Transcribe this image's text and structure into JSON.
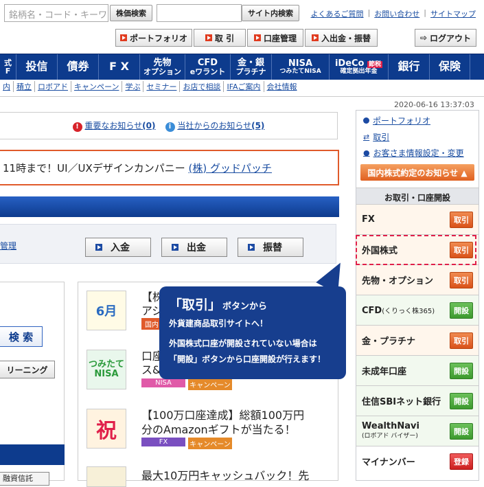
{
  "header": {
    "search_placeholder": "銘柄名・コード・キーワ",
    "stock_search": "株価検索",
    "site_search": "サイト内検索",
    "links": [
      "よくあるご質問",
      "お問い合わせ",
      "サイトマップ"
    ],
    "buttons": [
      "ポートフォリオ",
      "取 引",
      "口座管理",
      "入出金・振替"
    ],
    "logout": "ログアウト"
  },
  "nav": {
    "items": [
      {
        "l1": "式",
        "l2": "F"
      },
      {
        "l1": "投信",
        "l2": ""
      },
      {
        "l1": "債券",
        "l2": ""
      },
      {
        "l1": "F X",
        "l2": ""
      },
      {
        "l1": "先物",
        "l2": "オプション"
      },
      {
        "l1": "CFD",
        "l2": "eワラント"
      },
      {
        "l1": "金・銀",
        "l2": "プラチナ"
      },
      {
        "l1": "NISA",
        "l2": "つみたてNISA"
      },
      {
        "l1": "iDeCo",
        "l2": "確定拠出年金"
      },
      {
        "l1": "銀行",
        "l2": ""
      },
      {
        "l1": "保険",
        "l2": ""
      }
    ],
    "ideco_badge": "節税",
    "sub": [
      "内",
      "積立",
      "ロボアド",
      "キャンペーン",
      "学ぶ",
      "セミナー",
      "お店で相談",
      "IFAご案内",
      "会社情報"
    ]
  },
  "notices": {
    "important": "重要なお知らせ",
    "important_count": "(0)",
    "company": "当社からのお知らせ",
    "company_count": "(5)"
  },
  "banner": {
    "text": "11時まで！UI／UXデザインカンパニー",
    "link": "(株) グッドパッチ"
  },
  "account": {
    "manage": "管理",
    "deposit": "入金",
    "withdraw": "出金",
    "transfer": "振替"
  },
  "left": {
    "search_btn": "検 索",
    "screening": "リーニング",
    "bottom": "融資信託"
  },
  "news": [
    {
      "icon": "6月",
      "title1": "【株",
      "title2": "アジ",
      "tag1": "国内",
      "tag2": ""
    },
    {
      "icon": "つみたて NISA",
      "title1": "口座",
      "title2": "ス&",
      "tag1": "NISA",
      "tag2": "キャンペーン"
    },
    {
      "icon": "祝",
      "title1": "【100万口座達成】総額100万円",
      "title2": "分のAmazonギフトが当たる！",
      "tag1": "FX",
      "tag2": "キャンペーン"
    },
    {
      "icon": "",
      "title1": "最大10万円キャッシュバック！先",
      "title2": "",
      "tag1": "",
      "tag2": ""
    }
  ],
  "right": {
    "timestamp": "2020-06-16 13:37:03",
    "links": [
      "ポートフォリオ",
      "取引",
      "お客さま情報設定・変更"
    ],
    "stock_notice": "国内株式約定のお知らせ ▲",
    "section": "お取引・口座開設",
    "services": [
      {
        "name": "FX",
        "btn": "取引",
        "color": "or"
      },
      {
        "name": "外国株式",
        "btn": "取引",
        "color": "or"
      },
      {
        "name": "先物・オプション",
        "btn": "取引",
        "color": "or"
      },
      {
        "name": "CFD",
        "sub": "(くりっく株365)",
        "btn": "開設",
        "color": "gr"
      },
      {
        "name": "金・プラチナ",
        "btn": "取引",
        "color": "or"
      },
      {
        "name": "未成年口座",
        "btn": "開設",
        "color": "gr"
      },
      {
        "name": "住信SBIネット銀行",
        "btn": "開設",
        "color": "gr"
      },
      {
        "name": "WealthNavi",
        "sub": "(ロボアド バイザー)",
        "btn": "開設",
        "color": "gr"
      },
      {
        "name": "マイナンバー",
        "btn": "登録",
        "color": "rd"
      }
    ]
  },
  "callout": {
    "h1": "「取引」",
    "h1_rest": "ボタンから",
    "line2": "外貨建商品取引サイトへ！",
    "line3": "外国株式口座が開設されていない場合は",
    "line4a": "「開設」",
    "line4b": "ボタンから口座開設が行えます！"
  }
}
